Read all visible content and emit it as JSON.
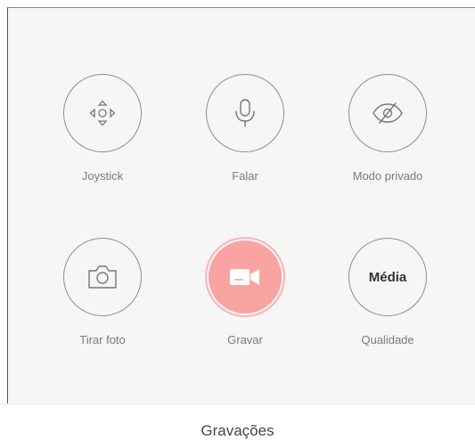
{
  "controls": {
    "joystick": {
      "label": "Joystick",
      "icon": "joystick-icon"
    },
    "talk": {
      "label": "Falar",
      "icon": "microphone-icon"
    },
    "privacy": {
      "label": "Modo privado",
      "icon": "eye-slash-icon"
    },
    "photo": {
      "label": "Tirar foto",
      "icon": "camera-icon"
    },
    "record": {
      "label": "Gravar",
      "icon": "video-camera-icon"
    },
    "quality": {
      "label": "Qualidade",
      "value": "Média"
    }
  },
  "footer": {
    "recordings_label": "Gravações"
  },
  "colors": {
    "record_accent": "#f9a3a3",
    "panel_background": "#f6f6f6",
    "label_text": "#7b7b7b"
  }
}
